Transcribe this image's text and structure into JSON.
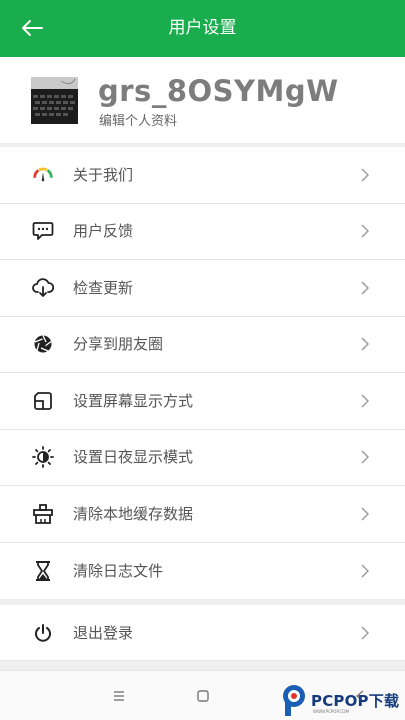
{
  "header": {
    "title": "用户设置",
    "back_icon": "arrow-left-icon",
    "color": "#1aad4e"
  },
  "profile": {
    "username": "grs_8OSYMgW",
    "edit_label": "编辑个人资料"
  },
  "menu": {
    "items": [
      {
        "label": "关于我们",
        "icon": "gauge-icon"
      },
      {
        "label": "用户反馈",
        "icon": "chat-bubble-icon"
      },
      {
        "label": "检查更新",
        "icon": "cloud-download-icon"
      },
      {
        "label": "分享到朋友圈",
        "icon": "aperture-icon"
      },
      {
        "label": "设置屏幕显示方式",
        "icon": "screen-display-icon"
      },
      {
        "label": "设置日夜显示模式",
        "icon": "brightness-icon"
      },
      {
        "label": "清除本地缓存数据",
        "icon": "clear-cache-icon"
      },
      {
        "label": "清除日志文件",
        "icon": "hourglass-icon"
      }
    ]
  },
  "logout": {
    "label": "退出登录",
    "icon": "power-icon"
  },
  "navbar": {
    "buttons": [
      "menu-icon",
      "home-icon",
      "back-icon"
    ]
  },
  "watermark": {
    "text": "PCPOP下载",
    "subtext": "WWW.PCPOP.COM"
  }
}
